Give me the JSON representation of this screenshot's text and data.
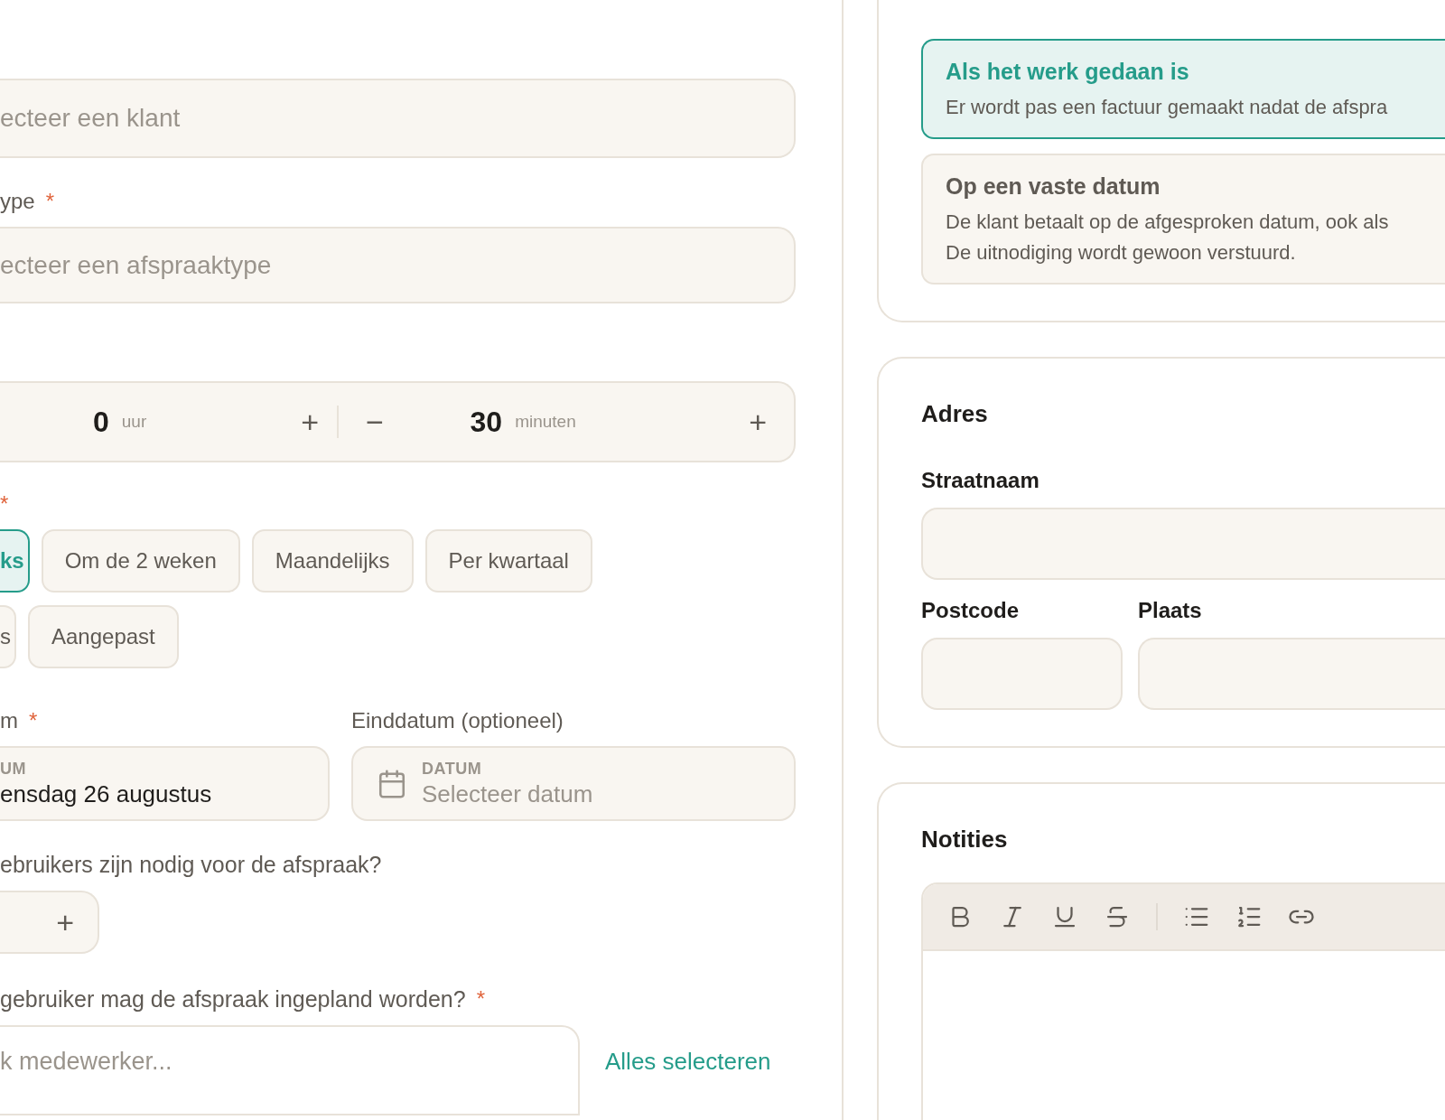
{
  "client_field": {
    "placeholder": "ecteer een klant"
  },
  "type_field": {
    "label": "ype",
    "required_mark": "*",
    "placeholder": "ecteer een afspraaktype"
  },
  "duration": {
    "hours": {
      "value": "0",
      "unit": "uur",
      "plus": "+"
    },
    "minutes": {
      "minus": "−",
      "value": "30",
      "unit": "minuten",
      "plus": "+"
    }
  },
  "frequency": {
    "required_mark": "*",
    "rows": [
      [
        {
          "label": "ks",
          "selected": true
        },
        {
          "label": "Om de 2 weken",
          "selected": false
        },
        {
          "label": "Maandelijks",
          "selected": false
        },
        {
          "label": "Per kwartaal",
          "selected": false
        }
      ],
      [
        {
          "label": "s",
          "selected": false
        },
        {
          "label": "Aangepast",
          "selected": false
        }
      ]
    ]
  },
  "start_date": {
    "label": "m",
    "required_mark": "*",
    "caption": "UM",
    "value": "ensdag 26 augustus"
  },
  "end_date": {
    "label": "Einddatum (optioneel)",
    "caption": "DATUM",
    "placeholder": "Selecteer datum"
  },
  "users_needed": {
    "question": "ebruikers zijn nodig voor de afspraak?",
    "plus": "+"
  },
  "assignees": {
    "question": "gebruiker mag de afspraak ingepland worden?",
    "required_mark": "*",
    "search_placeholder": "k medewerker...",
    "select_all": "Alles selecteren"
  },
  "invoice_options": [
    {
      "title": "Als het werk gedaan is",
      "lines": [
        "Er wordt pas een factuur gemaakt nadat de afspra"
      ],
      "selected": true
    },
    {
      "title": "Op een vaste datum",
      "lines": [
        "De klant betaalt op de afgesproken datum, ook als",
        "De uitnodiging wordt gewoon verstuurd."
      ],
      "selected": false
    }
  ],
  "address": {
    "title": "Adres",
    "street_label": "Straatnaam",
    "postcode_label": "Postcode",
    "city_label": "Plaats"
  },
  "notes": {
    "title": "Notities",
    "toolbar": [
      {
        "kind": "bold"
      },
      {
        "kind": "italic"
      },
      {
        "kind": "underline"
      },
      {
        "kind": "strike"
      },
      {
        "kind": "divider"
      },
      {
        "kind": "bullets"
      },
      {
        "kind": "numbers"
      },
      {
        "kind": "link"
      }
    ]
  }
}
